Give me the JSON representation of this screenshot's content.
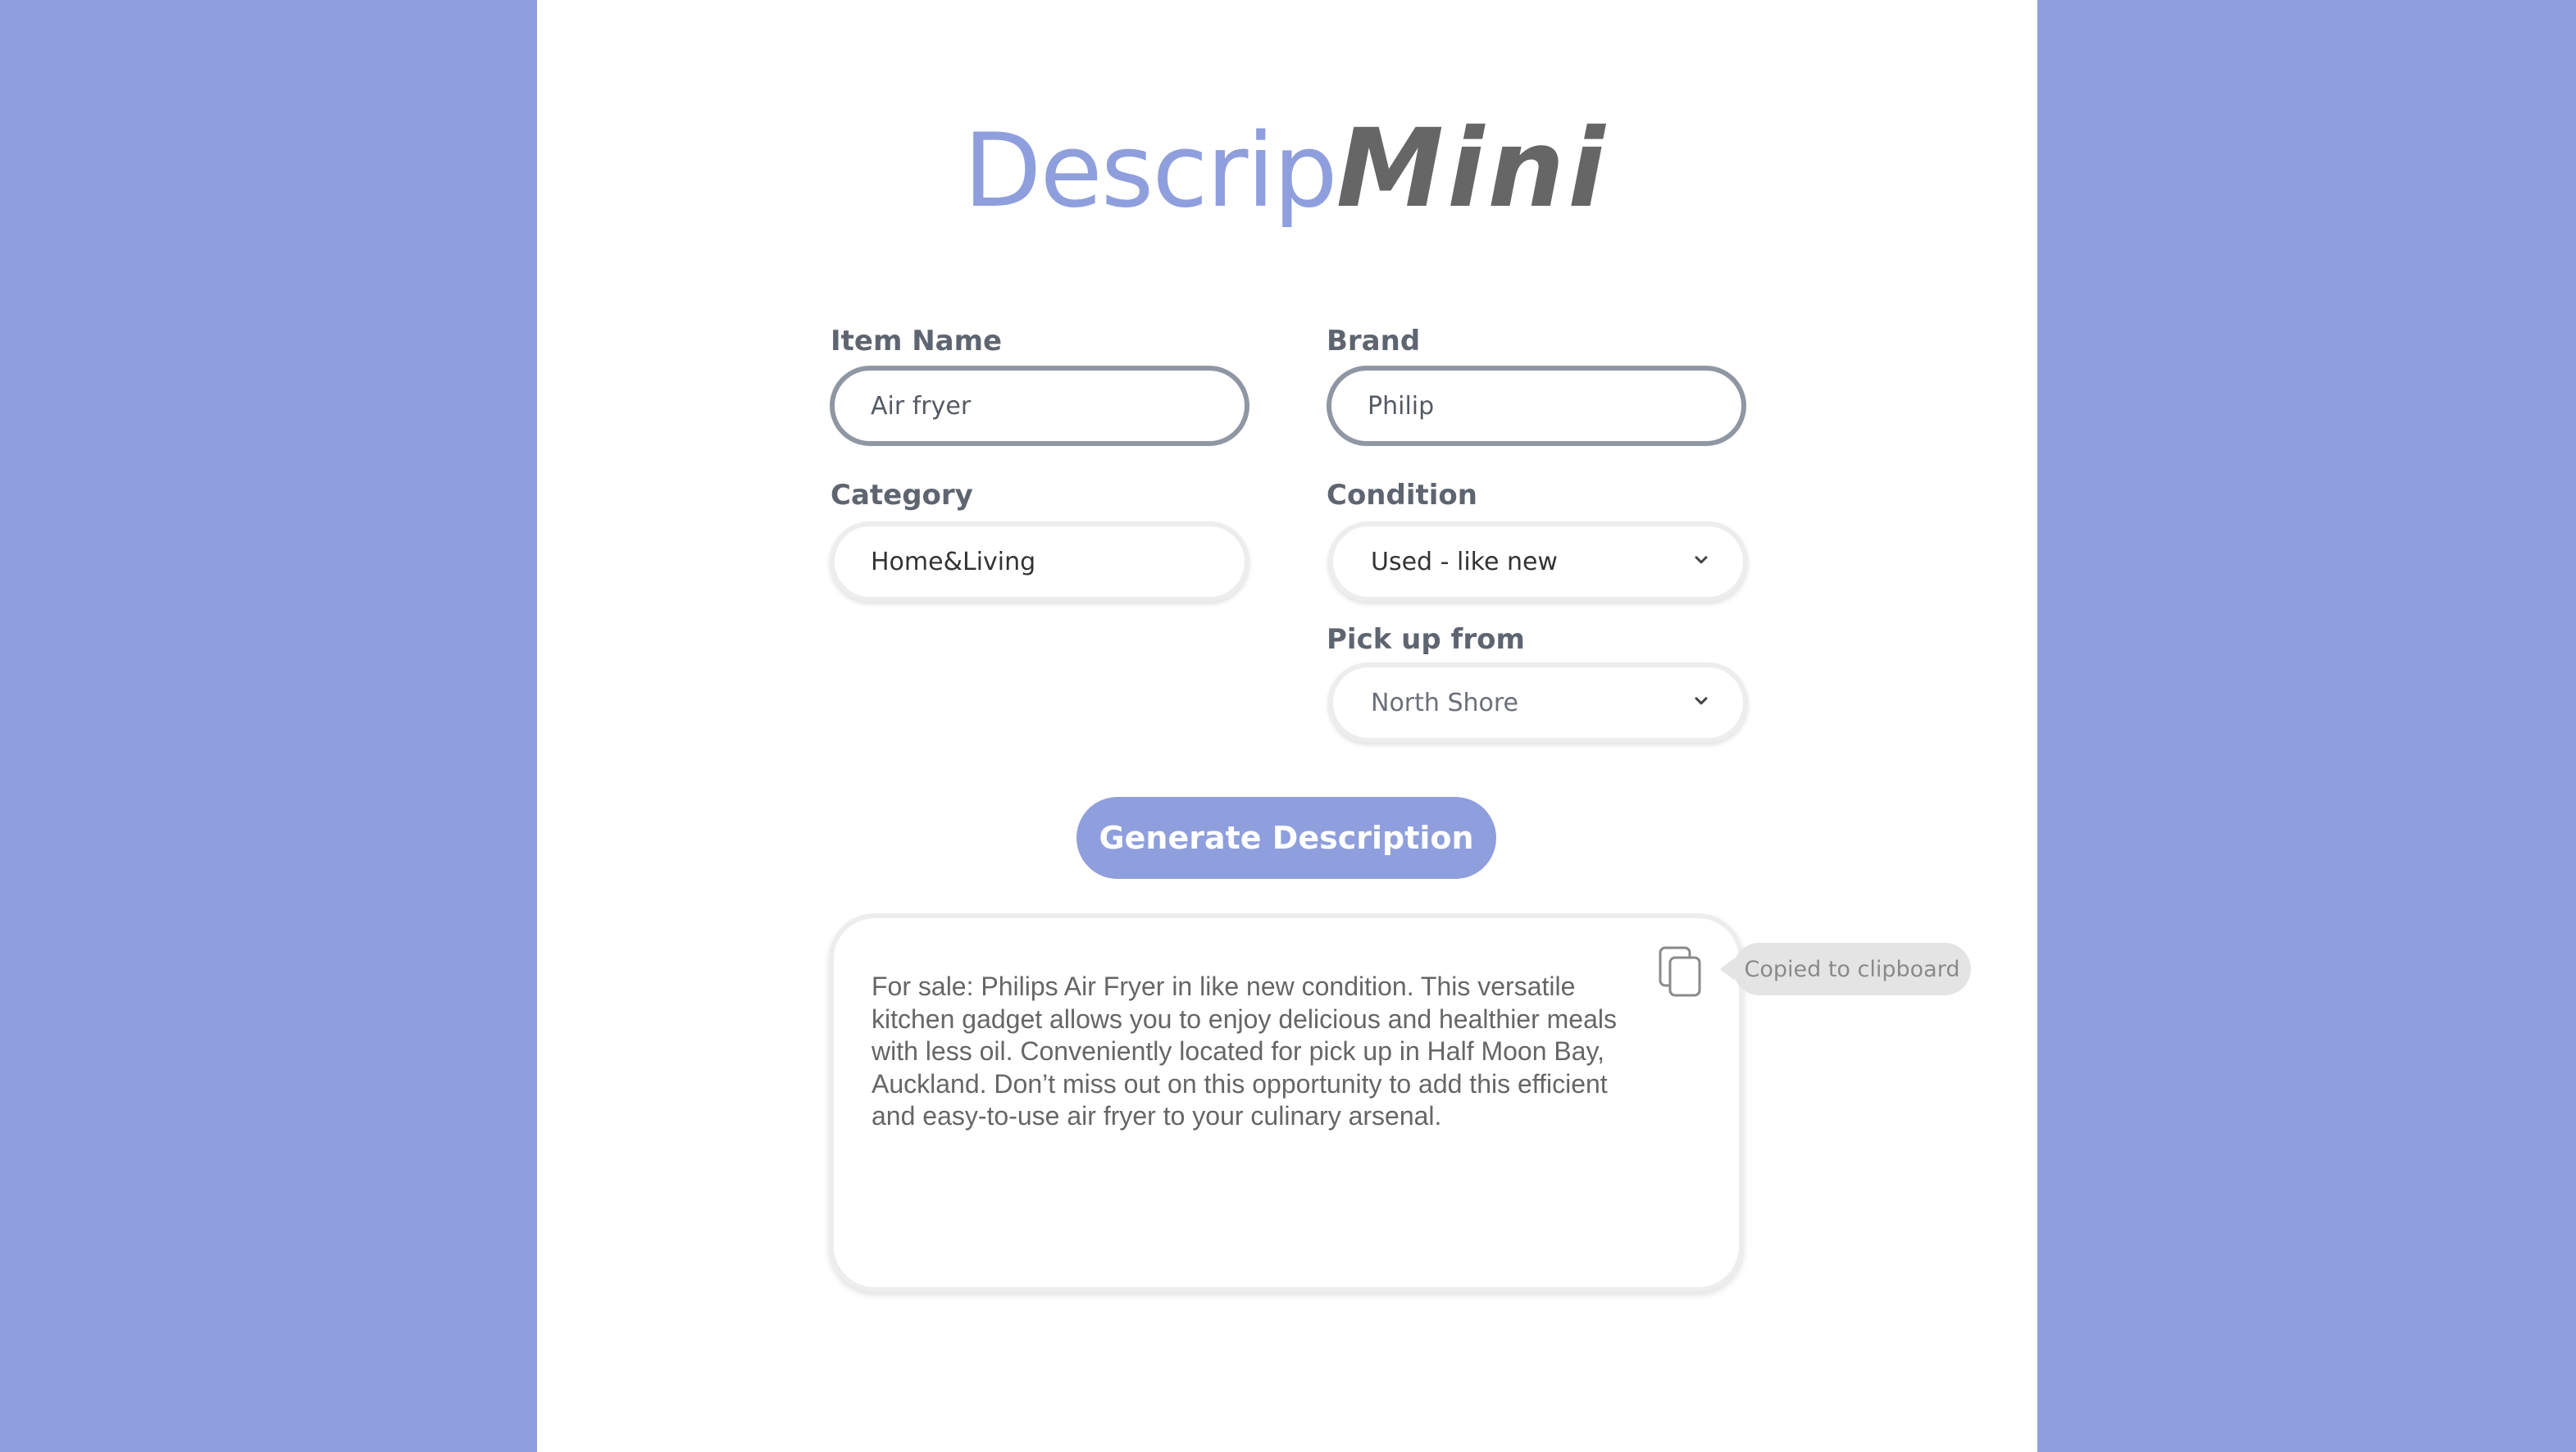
{
  "app": {
    "logo_part1": "Descrip",
    "logo_part2": "Mini"
  },
  "form": {
    "item_name": {
      "label": "Item Name",
      "value": "Air fryer"
    },
    "brand": {
      "label": "Brand",
      "value": "Philip"
    },
    "category": {
      "label": "Category",
      "value": "Home&Living"
    },
    "condition": {
      "label": "Condition",
      "selected": "Used - like new"
    },
    "pickup": {
      "label": "Pick up from",
      "selected": "North Shore"
    }
  },
  "actions": {
    "generate_label": "Generate Description"
  },
  "output": {
    "text": "For sale: Philips Air Fryer in like new condition. This versatile kitchen gadget allows you to enjoy delicious and healthier meals with less oil. Conveniently located for pick up in Half Moon Bay, Auckland. Don’t miss out on this opportunity to add this efficient and easy-to-use air fryer to your culinary arsenal.",
    "copy_icon": "copy-icon",
    "toast": "Copied to clipboard"
  },
  "colors": {
    "accent": "#8f9fdd",
    "logo_dark": "#666666",
    "active_border": "#8f97a3"
  }
}
